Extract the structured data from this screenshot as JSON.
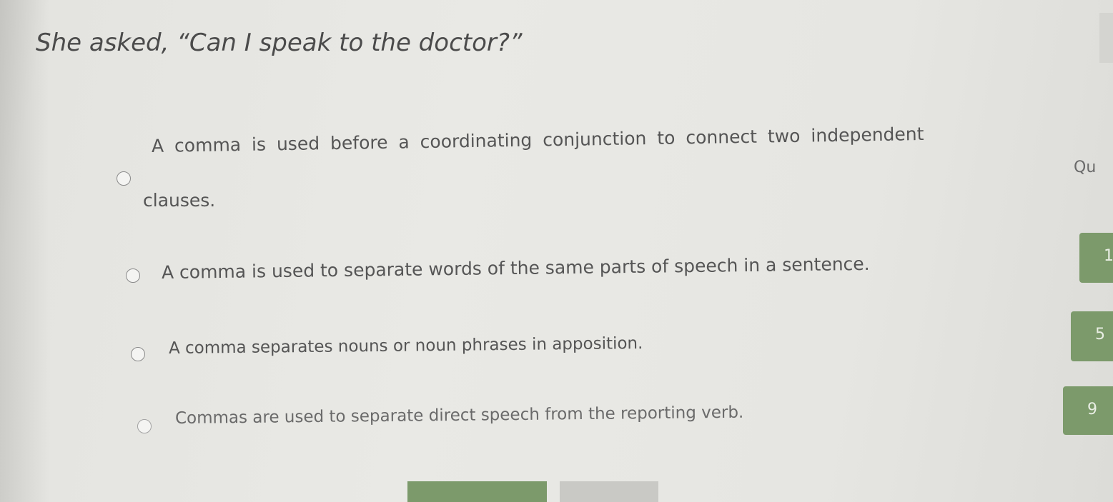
{
  "question": {
    "text": "She asked, “Can I speak to the doctor?”"
  },
  "options": [
    {
      "line1": "A comma is used before a coordinating conjunction to connect two independent",
      "line2": "clauses."
    },
    {
      "text": "A comma is used to separate words of the same parts of speech in a sentence."
    },
    {
      "text": "A comma separates nouns or noun phrases in apposition."
    },
    {
      "text": "Commas are used to separate direct speech from the reporting verb."
    }
  ],
  "sidebar": {
    "header_fragment": "Qu",
    "question_numbers": [
      "1",
      "5",
      "9"
    ]
  },
  "colors": {
    "accent_green": "#7c9a6b",
    "bottom_gray": "#c9c9c5",
    "text": "#555555"
  }
}
